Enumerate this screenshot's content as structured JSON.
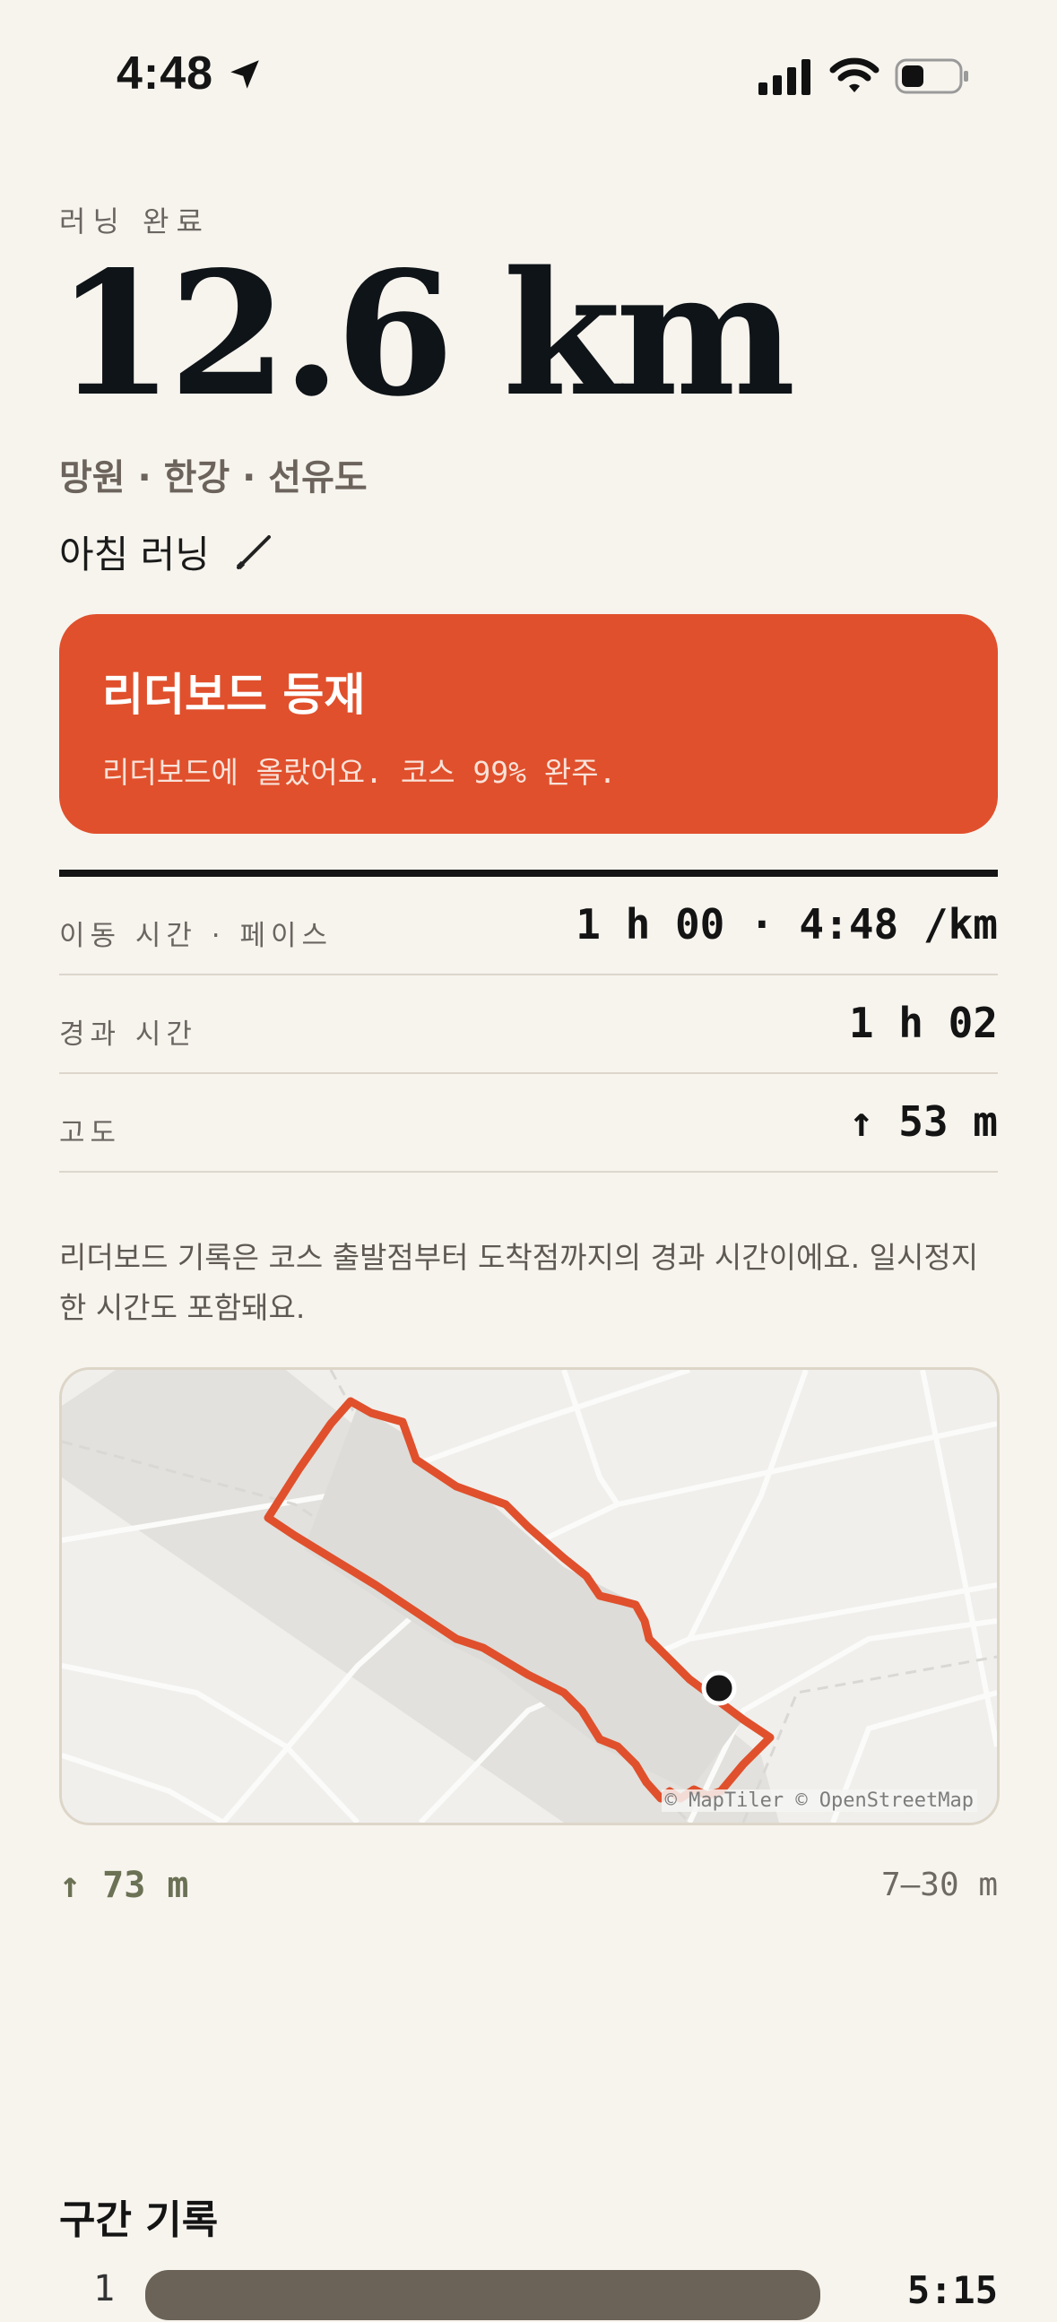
{
  "status": {
    "time": "4:48"
  },
  "summary": {
    "eyebrow": "러닝 완료",
    "distance": "12.6 km",
    "places": "망원 · 한강 · 선유도",
    "run_name": "아침 러닝"
  },
  "leaderboard": {
    "title": "리더보드 등재",
    "subtitle": "리더보드에 올랐어요. 코스 99% 완주."
  },
  "stats": [
    {
      "label": "이동 시간 · 페이스",
      "value": "1 h 00 · 4:48 /km"
    },
    {
      "label": "경과 시간",
      "value": "1 h 02"
    },
    {
      "label": "고도",
      "value": "↑ 53 m"
    }
  ],
  "note": "리더보드 기록은 코스 출발점부터 도착점까지의 경과 시간이에요. 일시정지한 시간도 포함돼요.",
  "map": {
    "attribution": "© MapTiler © OpenStreetMap",
    "route_color": "#e0502c"
  },
  "elevation": {
    "gain": "↑ 73 m",
    "range": "7–30 m"
  },
  "splits": {
    "title": "구간 기록",
    "rows": [
      {
        "index": "1",
        "time": "5:15"
      }
    ]
  },
  "colors": {
    "background": "#f7f4ee",
    "accent": "#e0502c",
    "split_bar": "#6b6357"
  }
}
